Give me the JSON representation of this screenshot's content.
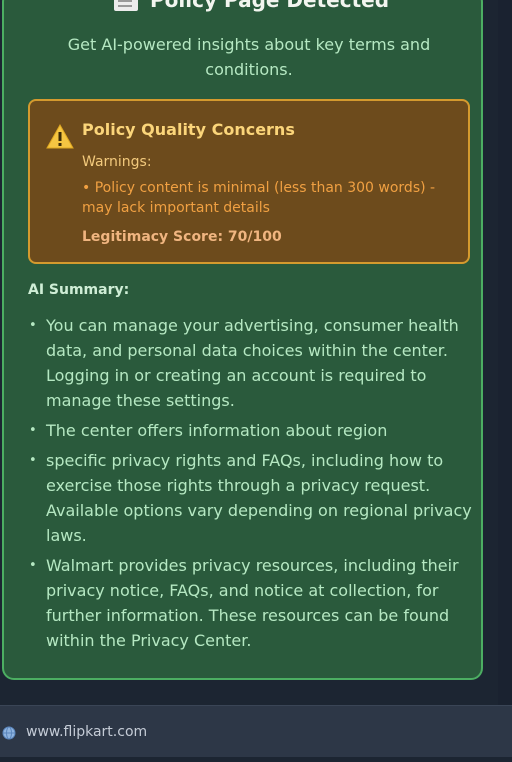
{
  "header": {
    "title": "Policy Page Detected",
    "icon": "document-icon"
  },
  "subtitle": "Get AI-powered insights about key terms and conditions.",
  "warning_box": {
    "icon": "warning-icon",
    "title": "Policy Quality Concerns",
    "warnings_label": "Warnings:",
    "warnings": [
      "Policy content is minimal (less than 300 words) - may lack important details"
    ],
    "score_text": "Legitimacy Score: 70/100"
  },
  "summary": {
    "label": "AI Summary:",
    "items": [
      "You can manage your advertising, consumer health data, and personal data choices within the center. Logging in or creating an account is required to manage these settings.",
      "The center offers information about region",
      "specific privacy rights and FAQs, including how to exercise those rights through a privacy request. Available options vary depending on regional privacy laws.",
      "Walmart provides privacy resources, including their privacy notice, FAQs, and notice at collection, for further information. These resources can be found within the Privacy Center."
    ]
  },
  "footer": {
    "icon": "globe-icon",
    "url": "www.flipkart.com"
  },
  "colors": {
    "panel": "#2a5a3c",
    "panel_border": "#4cae62",
    "warning_bg": "#6d4b1c",
    "warning_border": "#d49a2e"
  }
}
